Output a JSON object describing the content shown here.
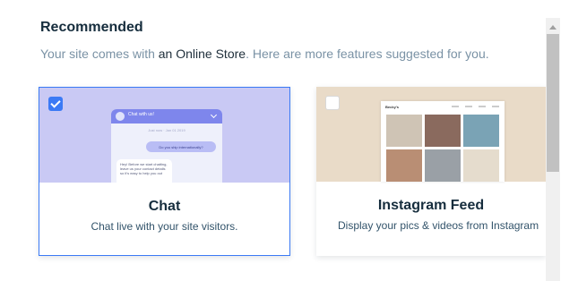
{
  "section": {
    "heading": "Recommended",
    "subtitle_pre": "Your site comes with ",
    "subtitle_highlight": "an Online Store",
    "subtitle_post": ". Here are more features suggested for you."
  },
  "cards": [
    {
      "title": "Chat",
      "description": "Chat live with your site visitors.",
      "checked": true,
      "preview": {
        "header": "Chat with us!",
        "date": "Just now · Jan 01 2019",
        "user_message": "Do you ship internationally?",
        "reply": "Hey! Before we start chatting, leave us your contact details so it's easy to help you out"
      }
    },
    {
      "title": "Instagram Feed",
      "description": "Display your pics & videos from Instagram",
      "checked": false,
      "preview": {
        "brand": "Becky's",
        "photo_colors": [
          "#cfc4b5",
          "#8a6a5e",
          "#7aa3b5",
          "#b98e74",
          "#9aa0a6",
          "#e5dccd"
        ]
      }
    }
  ],
  "colors": {
    "accent": "#3b7af5",
    "chat_thumb": "#c9c9f4",
    "insta_thumb": "#e9dbc8"
  }
}
